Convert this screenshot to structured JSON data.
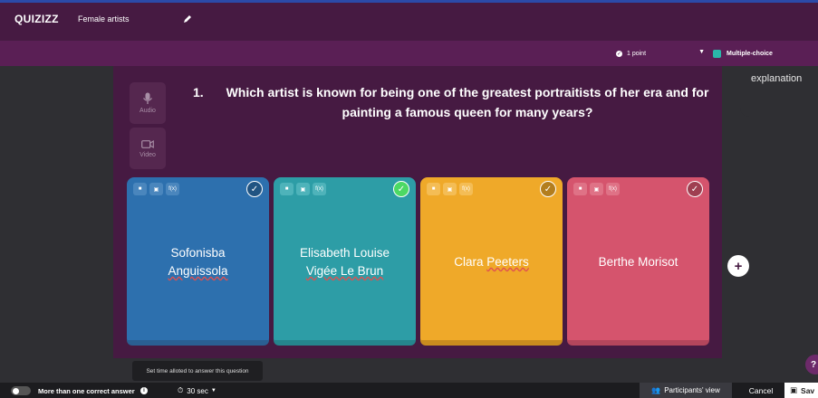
{
  "header": {
    "logo": "QUIZIZZ",
    "quiz_title": "Female artists"
  },
  "settings": {
    "points": "1 point",
    "question_type": "Multiple-choice"
  },
  "explanation_tab": "explanation",
  "media": {
    "audio_label": "Audio",
    "video_label": "Video"
  },
  "question": {
    "number": "1.",
    "text": "Which artist is known for being one of the greatest portraitists of her era and for painting a famous queen for many years?"
  },
  "answers": [
    {
      "line1": "Sofonisba",
      "line2": "Anguissola",
      "color": "#2d70ae",
      "bottom": "#2a5f92",
      "tool_bg": "#4a86bd",
      "correct": false
    },
    {
      "line1": "Elisabeth Louise",
      "line2": "Vigée Le Brun",
      "color": "#2d9da6",
      "bottom": "#25858d",
      "tool_bg": "#4eb3ba",
      "correct": true
    },
    {
      "line1": "Clara ",
      "line2": "Peeters",
      "color": "#efa929",
      "bottom": "#c98c1e",
      "tool_bg": "#f4bd55",
      "correct": false
    },
    {
      "line1": "Berthe Morisot",
      "line2": "",
      "color": "#d5546d",
      "bottom": "#b3465c",
      "tool_bg": "#df7286",
      "correct": false
    }
  ],
  "tooltip": "Set time alloted to answer this question",
  "footer": {
    "multi_correct_label": "More than one correct answer",
    "time_limit": "30 sec",
    "participants_view": "Participants' view",
    "cancel": "Cancel",
    "save": "Sav"
  },
  "help": "?"
}
